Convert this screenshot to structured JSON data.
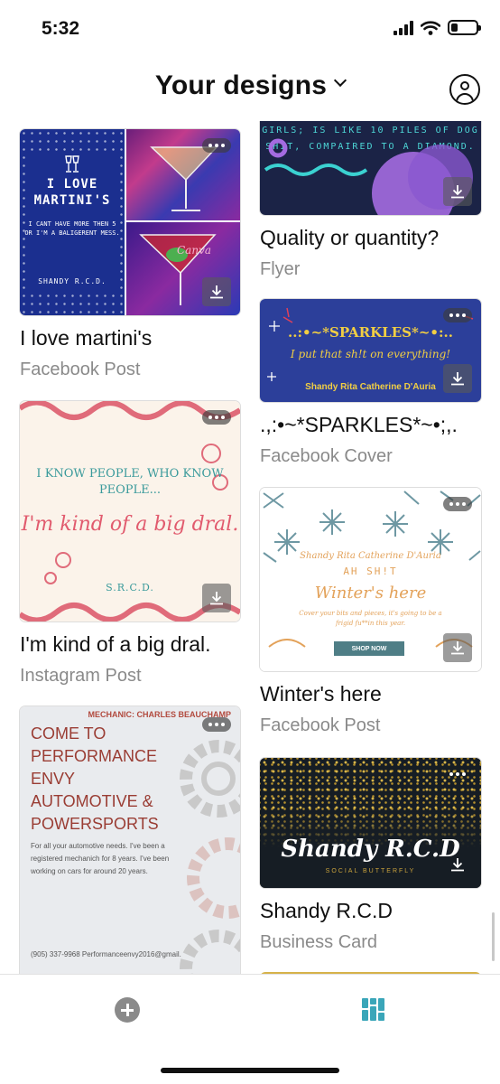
{
  "status": {
    "time": "5:32"
  },
  "header": {
    "title": "Your designs"
  },
  "designs": [
    {
      "title": "I love martini's",
      "type": "Facebook Post",
      "thumb": {
        "headline": "I LOVE MARTINI'S",
        "body": "I CANT HAVE MORE THEN 5 OR I'M A BALIGERENT MESS.",
        "signature": "SHANDY R.C.D.",
        "watermark": "Canva"
      }
    },
    {
      "title": "I'm kind of a big dral.",
      "type": "Instagram Post",
      "thumb": {
        "line1": "I KNOW PEOPLE, WHO KNOW PEOPLE...",
        "line2": "I'm kind of a big dral.",
        "line3": "S.R.C.D."
      }
    },
    {
      "title": "",
      "type": "",
      "thumb": {
        "header": "MECHANIC: CHARLES BEAUCHAMP",
        "headline": "COME TO PERFORMANCE ENVY AUTOMOTIVE & POWERSPORTS",
        "body": "For all your automotive needs. I've been a registered mechanich for 8 years. I've been working on cars for around 20 years.",
        "contact": "(905) 337-9968 Performanceenvy2016@gmail."
      }
    },
    {
      "title": "Quality or quantity?",
      "type": "Flyer",
      "thumb": {
        "text": "GIRLS; IS LIKE 10 PILES OF DOG SHIT, COMPAIRED TO A DIAMOND."
      }
    },
    {
      "title": ".,:•~*SPARKLES*~•;,.",
      "type": "Facebook Cover",
      "thumb": {
        "headline": "..:•~*SPARKLES*~•:..",
        "tagline": "I put that sh!t on everything!",
        "signature": "Shandy Rita Catherine D'Auria"
      }
    },
    {
      "title": "Winter's here",
      "type": "Facebook Post",
      "thumb": {
        "name": "Shandy Rita Catherine D'Auria",
        "line": "AH SH!T",
        "headline": "Winter's here",
        "body": "Cover your bits and pieces, it's going to be a frigid fu**in this year.",
        "button": "SHOP NOW"
      }
    },
    {
      "title": "Shandy R.C.D",
      "type": "Business Card",
      "thumb": {
        "name": "Shandy R.C.D",
        "subtitle": "SOCIAL BUTTERFLY"
      }
    }
  ],
  "colors": {
    "accent": "#3aa6b9",
    "muted": "#8a8a8a"
  },
  "icons": {
    "add": "plus-circle-icon",
    "designs": "grid-icon",
    "account": "account-icon"
  }
}
